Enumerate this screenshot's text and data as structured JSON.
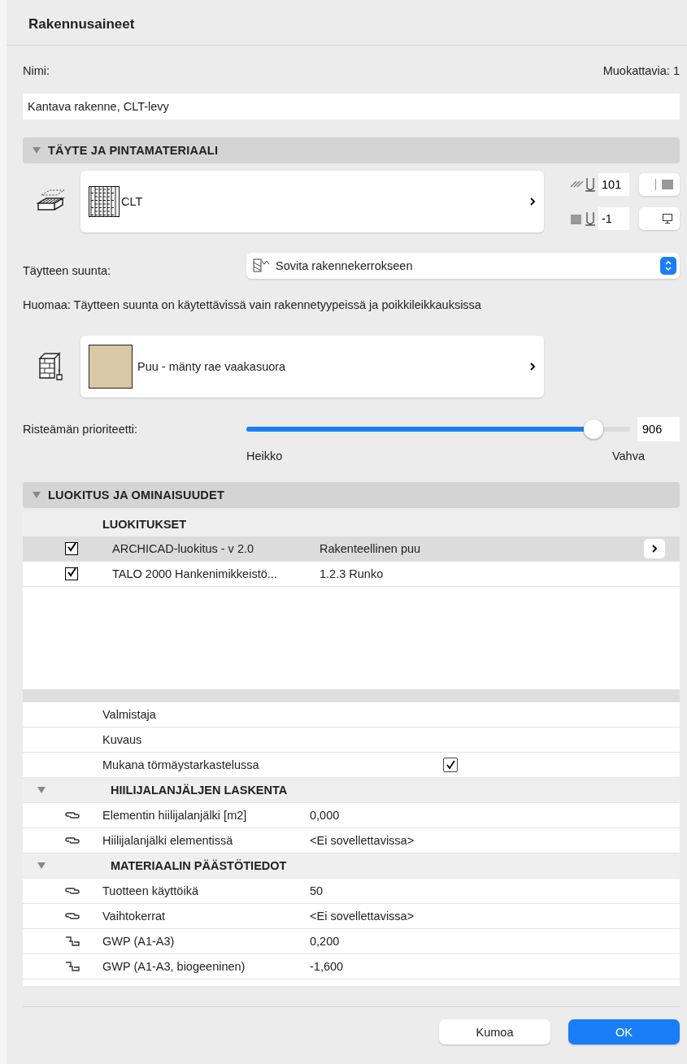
{
  "window": {
    "title": "Rakennusaineet"
  },
  "name": {
    "label": "Nimi:",
    "editable_count": "Muokattavia: 1",
    "value": "Kantava rakenne, CLT-levy"
  },
  "fill_section": {
    "title": "TÄYTE JA PINTAMATERIAALI",
    "expanded": true,
    "fill": {
      "name": "CLT",
      "pen_fg": "101",
      "pen_bg": "-1"
    },
    "direction": {
      "label": "Täytteen suunta:",
      "value": "Sovita rakennekerrokseen"
    },
    "note": "Huomaa: Täytteen suunta on käytettävissä vain rakennetyypeissä ja poikkileikkauksissa",
    "surface": {
      "name": "Puu - mänty rae vaakasuora",
      "color": "#d9c8a6"
    },
    "priority": {
      "label": "Risteämän prioriteetti:",
      "level": 0.885,
      "reading": "906",
      "min_label": "Heikko",
      "max_label": "Vahva"
    }
  },
  "class_section": {
    "title": "LUOKITUS JA OMINAISUUDET",
    "expanded": true,
    "classifications_heading": "LUOKITUKSET",
    "classifications": [
      {
        "system": "ARCHICAD-luokitus - v 2.0",
        "value": "Rakenteellinen puu",
        "checked": true,
        "selected": true
      },
      {
        "system": "TALO 2000 Hankenimikkeistö...",
        "value": "1.2.3 Runko",
        "checked": true,
        "selected": false
      }
    ],
    "properties": [
      {
        "kind": "property",
        "name": "Valmistaja"
      },
      {
        "kind": "property",
        "name": "Kuvaus"
      },
      {
        "kind": "checkbox",
        "name": "Mukana törmäystarkastelussa",
        "checked": true
      },
      {
        "kind": "group",
        "name": "HIILIJALANJÄLJEN LASKENTA",
        "expanded": true
      },
      {
        "kind": "property",
        "name": "Elementin hiilijalanjälki [m2]",
        "value": "0,000",
        "linked": true
      },
      {
        "kind": "property",
        "name": "Hiilijalanjälki elementissä",
        "value": "<Ei sovellettavissa>",
        "linked": true
      },
      {
        "kind": "group",
        "name": "MATERIAALIN PÄÄSTÖTIEDOT",
        "expanded": true
      },
      {
        "kind": "property",
        "name": "Tuotteen käyttöikä",
        "value": "50",
        "linked": true
      },
      {
        "kind": "property",
        "name": "Vaihtokerrat",
        "value": "<Ei sovellettavissa>",
        "linked": true
      },
      {
        "kind": "property",
        "name": "GWP (A1-A3)",
        "value": "0,200",
        "linked": false
      },
      {
        "kind": "property",
        "name": "GWP (A1-A3, biogeeninen)",
        "value": "-1,600",
        "linked": false
      }
    ]
  },
  "buttons": [
    {
      "label": "Kumoa",
      "kind": "cancel"
    },
    {
      "label": "OK",
      "kind": "default"
    }
  ]
}
